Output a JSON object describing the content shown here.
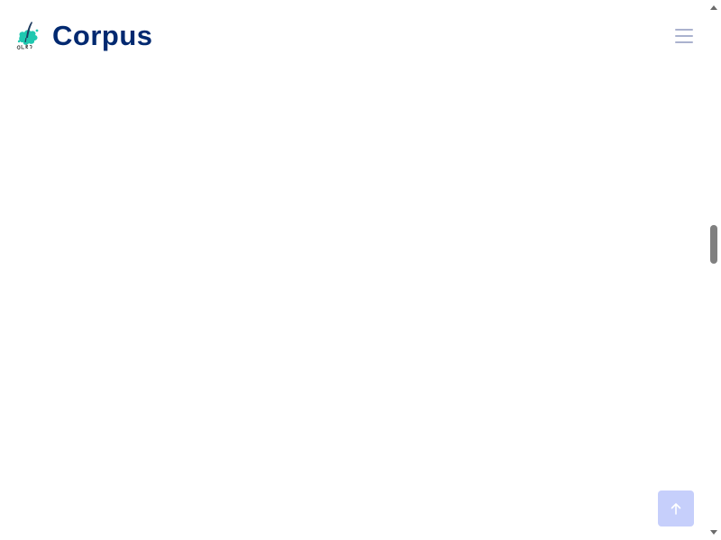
{
  "header": {
    "brand_name": "Corpus",
    "logo_icon": "quill-logo-icon",
    "menu_icon": "hamburger-menu-icon"
  },
  "back_to_top": {
    "icon": "arrow-up-icon"
  },
  "colors": {
    "brand_text": "#012970",
    "menu_icon": "#aab2ce",
    "back_to_top_bg": "#c6cffb",
    "logo_accent": "#1fc8b0"
  }
}
